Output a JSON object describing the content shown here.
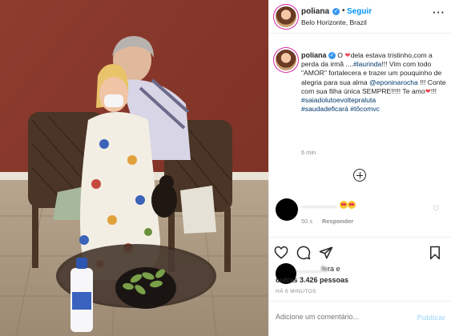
{
  "header": {
    "username": "poliana",
    "verified_icon": "verified-badge-icon",
    "follow_label": "Seguir",
    "separator": "•",
    "location": "Belo Horizonte, Brazil",
    "more_label": "···"
  },
  "caption": {
    "username": "poliana",
    "parts": {
      "p1": " O ",
      "heart": "❤",
      "p2": "dela estava tristinho,com a perda da irmã ....",
      "tag1": "#laurinda",
      "p3": "!!! Vim com todo \"AMOR\" fortalecera e trazer um pouquinho de alegria para sua alma ",
      "mention": "@eponinarocha",
      "p4": " !!! Conte com sua filha única SEMPRE!!!!! Te amo",
      "heart2": "❤",
      "p5": "!!!",
      "tag2": "#saiadolutoevoltepraluta",
      "tag3": "#saudadeficará",
      "tag4": "#tôcomvc"
    },
    "time": "6 min"
  },
  "comment": {
    "username": "_________",
    "time": "50 s",
    "reply_label": "Responder"
  },
  "likes": {
    "prefix_blurred": "_______fe",
    "line1_tail": "ra e",
    "count_text": "outras 3.426 pessoas",
    "post_time": "HÁ 6 MINUTOS"
  },
  "add_comment": {
    "placeholder": "Adicione um comentário...",
    "publish_label": "Publicar"
  },
  "colors": {
    "link_blue": "#0095f6",
    "hashtag": "#00376b",
    "heart": "#ed4956",
    "muted": "#8e8e8e"
  }
}
